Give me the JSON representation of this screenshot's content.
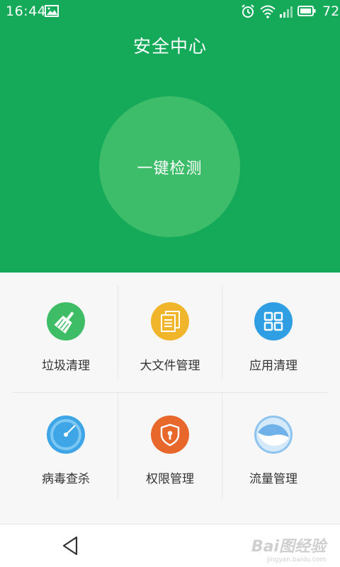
{
  "status_bar": {
    "time": "16:44",
    "battery": "72",
    "icons": [
      "gallery-icon",
      "alarm-icon",
      "wifi-icon",
      "signal-icon",
      "battery-icon"
    ]
  },
  "header": {
    "title": "安全中心",
    "scan_button_label": "一键检测",
    "background_color": "#14aa59",
    "circle_color": "#3dbc69"
  },
  "features": [
    {
      "label": "垃圾清理",
      "icon": "broom-icon",
      "color": "#3fbd66"
    },
    {
      "label": "大文件管理",
      "icon": "file-stack-icon",
      "color": "#f0b52a"
    },
    {
      "label": "应用清理",
      "icon": "app-grid-icon",
      "color": "#2f9ee3"
    },
    {
      "label": "病毒查杀",
      "icon": "radar-icon",
      "color": "#3ea6e6"
    },
    {
      "label": "权限管理",
      "icon": "shield-lock-icon",
      "color": "#e8682c"
    },
    {
      "label": "流量管理",
      "icon": "data-usage-icon",
      "color": "#8fc4ee"
    }
  ],
  "nav_bar": {
    "back_icon": "back-triangle-icon"
  },
  "watermark": {
    "main": "Bai图经验",
    "sub": "jingyan.baidu.com"
  }
}
